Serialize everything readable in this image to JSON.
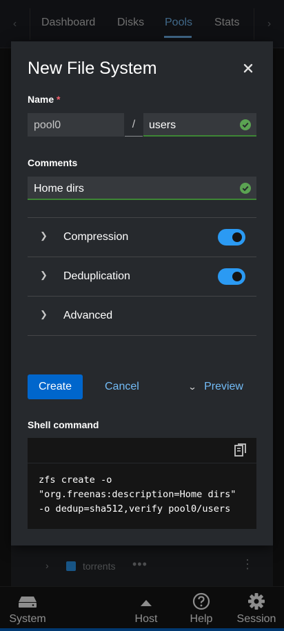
{
  "background": {
    "tabs": [
      {
        "label": "Dashboard",
        "active": false
      },
      {
        "label": "Disks",
        "active": false
      },
      {
        "label": "Pools",
        "active": true
      },
      {
        "label": "Stats",
        "active": false
      }
    ],
    "row": {
      "name": "torrents"
    }
  },
  "modal": {
    "title": "New File System",
    "name_label": "Name",
    "required_mark": "*",
    "pool_value": "pool0",
    "separator": "/",
    "name_value": "users",
    "comments_label": "Comments",
    "comments_value": "Home dirs",
    "sections": [
      {
        "label": "Compression",
        "toggle": true,
        "toggle_on": true
      },
      {
        "label": "Deduplication",
        "toggle": true,
        "toggle_on": true
      },
      {
        "label": "Advanced",
        "toggle": false
      }
    ],
    "create_label": "Create",
    "cancel_label": "Cancel",
    "preview_label": "Preview",
    "shell_label": "Shell command",
    "shell_command": "zfs create -o\n\"org.freenas:description=Home dirs\"\n-o dedup=sha512,verify pool0/users"
  },
  "bottom_nav": {
    "items": [
      {
        "label": "System",
        "icon": "server-icon"
      },
      {
        "label": "Host",
        "icon": "caret-up-icon"
      },
      {
        "label": "Help",
        "icon": "help-icon"
      },
      {
        "label": "Session",
        "icon": "gear-icon"
      }
    ]
  },
  "colors": {
    "accent": "#0066cc",
    "link": "#73bcf7",
    "success": "#3e8635",
    "toggle": "#2b9af3"
  }
}
